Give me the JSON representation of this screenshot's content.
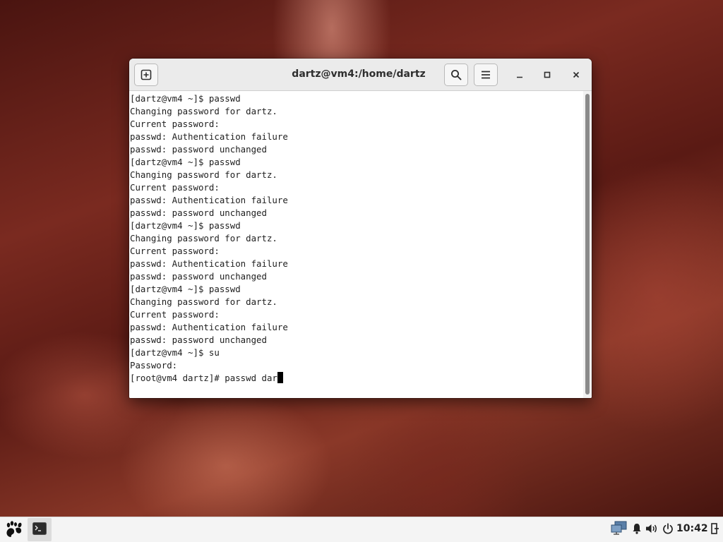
{
  "window": {
    "title": "dartz@vm4:/home/dartz"
  },
  "terminal": {
    "lines": [
      "[dartz@vm4 ~]$ passwd",
      "Changing password for dartz.",
      "Current password:",
      "passwd: Authentication failure",
      "passwd: password unchanged",
      "[dartz@vm4 ~]$ passwd",
      "Changing password for dartz.",
      "Current password:",
      "passwd: Authentication failure",
      "passwd: password unchanged",
      "[dartz@vm4 ~]$ passwd",
      "Changing password for dartz.",
      "Current password:",
      "passwd: Authentication failure",
      "passwd: password unchanged",
      "[dartz@vm4 ~]$ passwd",
      "Changing password for dartz.",
      "Current password:",
      "passwd: Authentication failure",
      "passwd: password unchanged",
      "[dartz@vm4 ~]$ su",
      "Password:"
    ],
    "current_input": "[root@vm4 dartz]# passwd dar"
  },
  "taskbar": {
    "clock": "10:42"
  },
  "icons": {
    "new_tab": "new-tab-icon",
    "search": "search-icon",
    "menu": "hamburger-menu-icon",
    "minimize": "minimize-icon",
    "maximize": "maximize-icon",
    "close": "close-icon",
    "app_menu": "gnome-foot-icon",
    "terminal_task": "terminal-icon",
    "network": "network-icon",
    "notifications": "bell-icon",
    "volume": "volume-icon",
    "power": "power-icon",
    "user": "user-switch-icon"
  },
  "colors": {
    "titlebar": "#ebebeb",
    "terminal_bg": "#ffffff",
    "terminal_fg": "#1e1e1e",
    "taskbar": "#f4f4f4"
  }
}
